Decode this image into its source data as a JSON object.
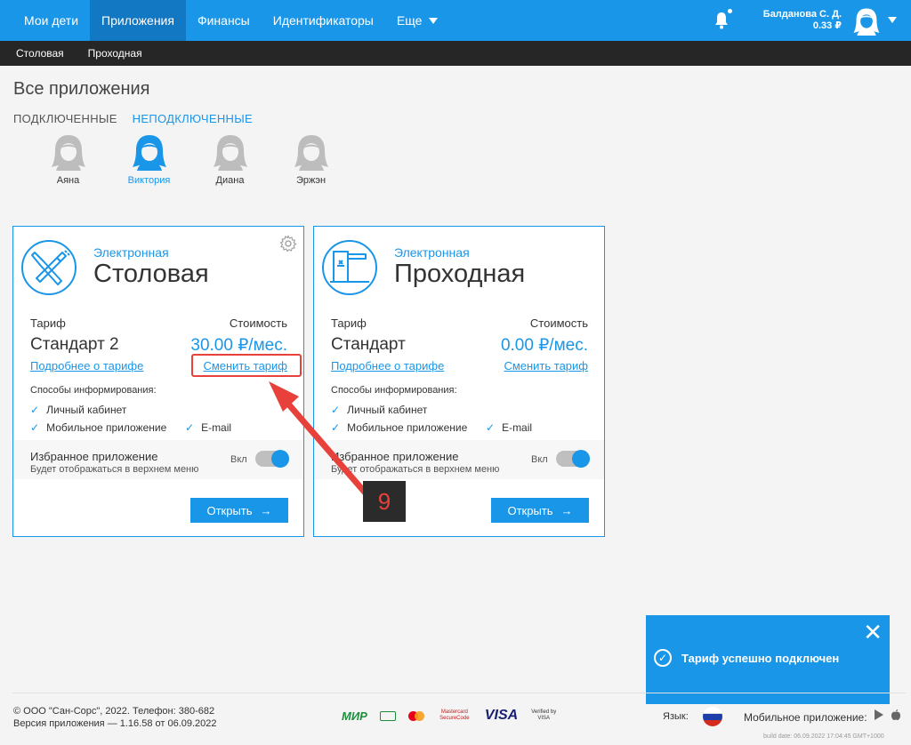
{
  "nav": {
    "items": [
      "Мои дети",
      "Приложения",
      "Финансы",
      "Идентификаторы",
      "Еще"
    ],
    "user_name": "Балданова С. Д.",
    "balance": "0.33 ₽"
  },
  "subnav": {
    "items": [
      "Столовая",
      "Проходная"
    ]
  },
  "page": {
    "title": "Все приложения",
    "tab_connected": "ПОДКЛЮЧЕННЫЕ",
    "tab_unconnected": "НЕПОДКЛЮЧЕННЫЕ"
  },
  "children": [
    "Аяна",
    "Виктория",
    "Диана",
    "Эржэн"
  ],
  "cards": [
    {
      "subtitle": "Электронная",
      "title": "Столовая",
      "tariff_label": "Тариф",
      "cost_label": "Стоимость",
      "tariff_name": "Стандарт 2",
      "price": "30.00 ₽/мес.",
      "more_link": "Подробнее о тарифе",
      "change_link": "Сменить тариф",
      "inform_title": "Способы информирования:",
      "channels": [
        "Личный кабинет",
        "Мобильное приложение",
        "E-mail"
      ],
      "fav_title": "Избранное приложение",
      "fav_desc": "Будет отображаться в верхнем меню",
      "toggle_label": "Вкл",
      "open_label": "Открыть"
    },
    {
      "subtitle": "Электронная",
      "title": "Проходная",
      "tariff_label": "Тариф",
      "cost_label": "Стоимость",
      "tariff_name": "Стандарт",
      "price": "0.00 ₽/мес.",
      "more_link": "Подробнее о тарифе",
      "change_link": "Сменить тариф",
      "inform_title": "Способы информирования:",
      "channels": [
        "Личный кабинет",
        "Мобильное приложение",
        "E-mail"
      ],
      "fav_title": "Избранное приложение",
      "fav_desc": "Будет отображаться в верхнем меню",
      "toggle_label": "Вкл",
      "open_label": "Открыть"
    }
  ],
  "annotation": {
    "step": "9"
  },
  "toast": {
    "message": "Тариф успешно подключен"
  },
  "footer": {
    "copyright": "© ООО \"Сан-Сорс\", 2022. Телефон: 380-682",
    "version": "Версия приложения — 1.16.58 от 06.09.2022",
    "payments": [
      "МИР",
      "Mastercard SecureCode",
      "VISA",
      "Verified by VISA"
    ],
    "language_label": "Язык:",
    "mobile_label": "Мобильное приложение:",
    "build": "build date: 06.09.2022 17:04:45 GMT+1000"
  },
  "colors": {
    "accent": "#1a96e8",
    "nav_active": "#1378c4",
    "subnav": "#262626",
    "annotation_red": "#e8403b"
  }
}
